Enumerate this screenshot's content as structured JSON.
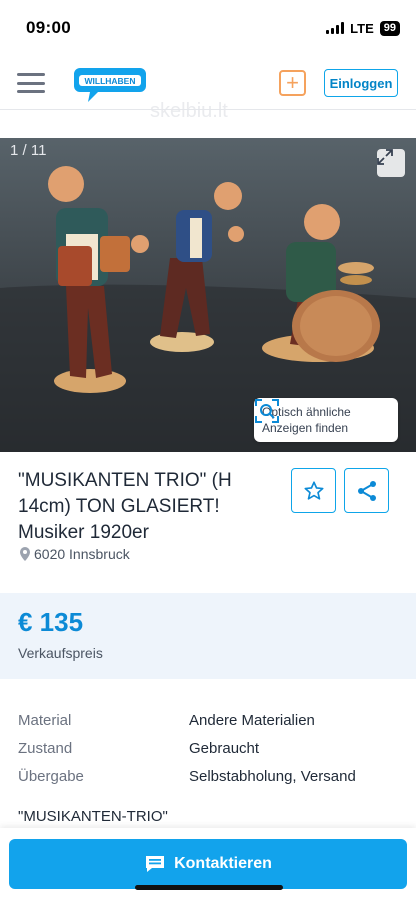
{
  "status_bar": {
    "time": "09:00",
    "network": "LTE",
    "battery": "99"
  },
  "header": {
    "logo_text": "WILLHABEN",
    "login_label": "Einloggen",
    "add_symbol": "+",
    "watermark": "skelbiu.lt"
  },
  "gallery": {
    "counter": "1 / 11",
    "visual_search_line1": "Optisch ähnliche",
    "visual_search_line2": "Anzeigen finden"
  },
  "listing": {
    "title": "\"MUSIKANTEN TRIO\" (H 14cm) TON GLASIERT! Musiker 1920er",
    "location": "6020 Innsbruck",
    "price": "€ 135",
    "price_label": "Verkaufspreis"
  },
  "attributes": [
    {
      "key": "Material",
      "value": "Andere Materialien"
    },
    {
      "key": "Zustand",
      "value": "Gebraucht"
    },
    {
      "key": "Übergabe",
      "value": "Selbstabholung, Versand"
    }
  ],
  "description_start": "\"MUSIKANTEN-TRIO\"",
  "cta": {
    "label": "Kontaktieren"
  },
  "colors": {
    "accent": "#12a3ec",
    "price": "#0c8ad6",
    "add_button": "#f5a25d"
  },
  "icons": [
    "menu-icon",
    "plus-icon",
    "expand-icon",
    "visual-search-icon",
    "star-icon",
    "share-icon",
    "location-pin-icon",
    "chat-icon"
  ]
}
